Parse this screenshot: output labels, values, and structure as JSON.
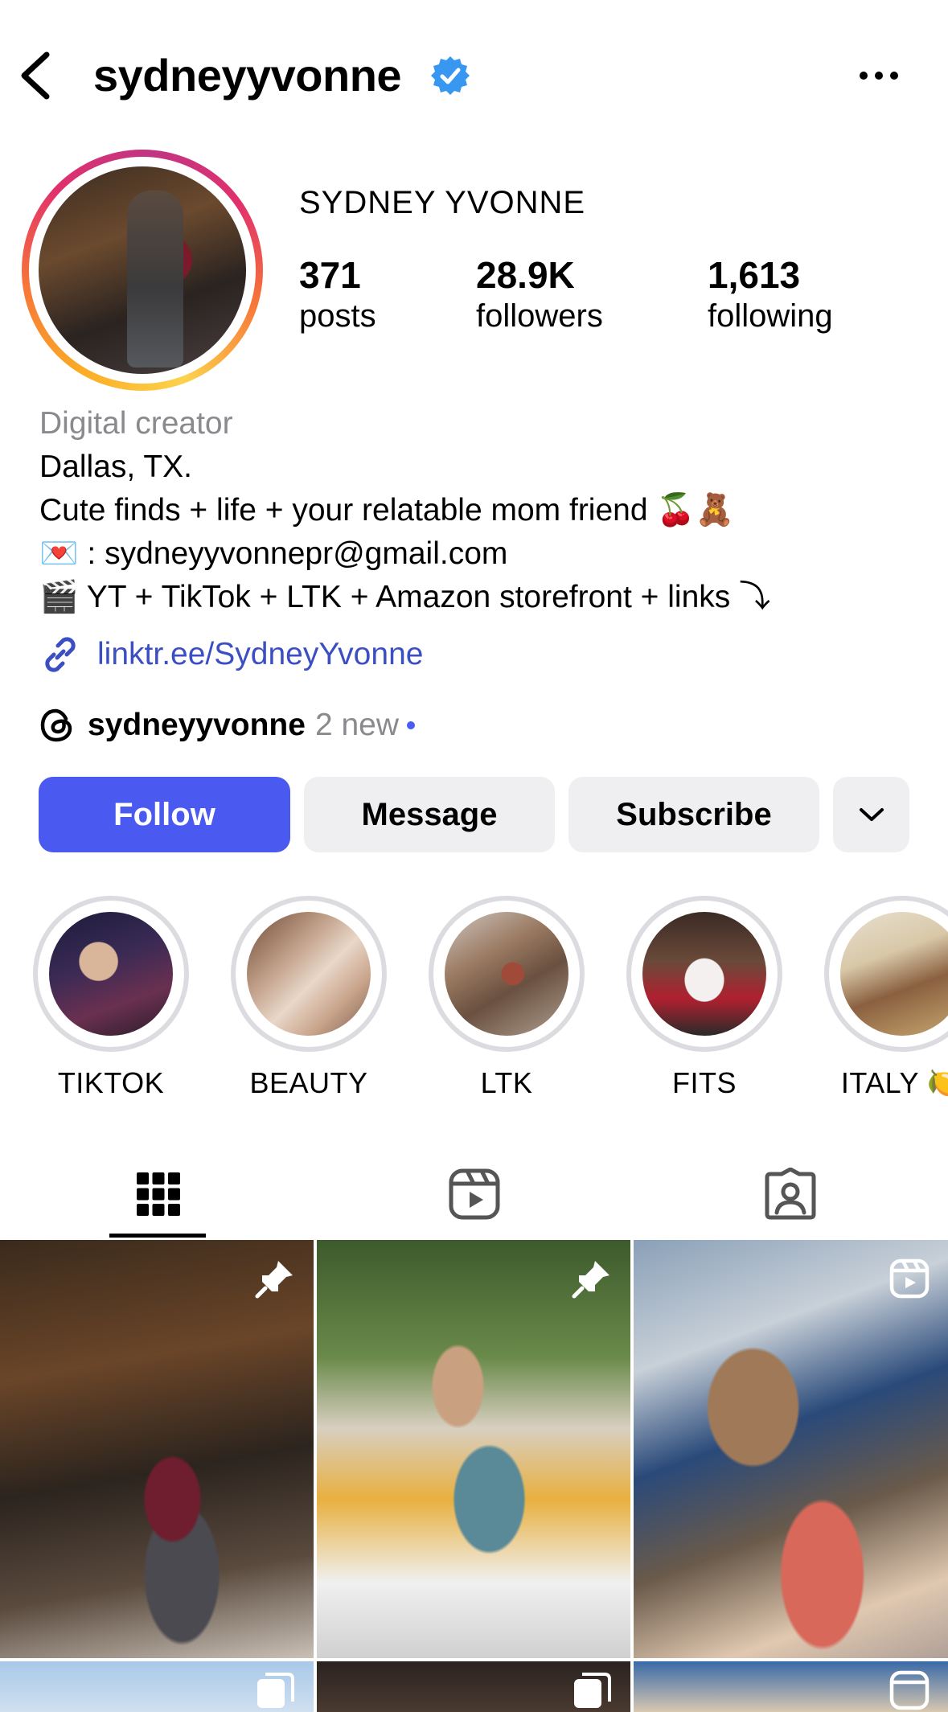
{
  "header": {
    "username": "sydneyyvonne",
    "back_icon": "chevron-left-icon",
    "verified_icon": "verified-badge-icon",
    "more_icon": "more-horizontal-icon"
  },
  "profile": {
    "full_name": "SYDNEY YVONNE",
    "stats": [
      {
        "value": "371",
        "label": "posts"
      },
      {
        "value": "28.9K",
        "label": "followers"
      },
      {
        "value": "1,613",
        "label": "following"
      }
    ],
    "category": "Digital creator",
    "bio_lines": [
      "Dallas, TX.",
      "Cute finds + life + your relatable mom friend 🍒🧸",
      "💌 : sydneyyvonnepr@gmail.com",
      "🎬 YT + TikTok + LTK + Amazon storefront + links ⤵︎"
    ],
    "link": "linktr.ee/SydneyYvonne",
    "link_icon": "link-icon",
    "threads": {
      "icon": "threads-icon",
      "name": "sydneyyvonne",
      "new_text": "2 new"
    }
  },
  "actions": {
    "follow": "Follow",
    "message": "Message",
    "subscribe": "Subscribe",
    "more_icon": "chevron-down-icon"
  },
  "highlights": [
    {
      "label": "TIKTOK"
    },
    {
      "label": "BEAUTY"
    },
    {
      "label": "LTK"
    },
    {
      "label": "FITS"
    },
    {
      "label": "ITALY 🍋"
    }
  ],
  "tabs": [
    {
      "name": "grid",
      "icon": "grid-icon",
      "active": true
    },
    {
      "name": "reels",
      "icon": "reels-icon",
      "active": false
    },
    {
      "name": "tagged",
      "icon": "tagged-user-icon",
      "active": false
    }
  ],
  "posts": [
    {
      "badge": "pin-icon"
    },
    {
      "badge": "pin-icon"
    },
    {
      "badge": "reel-icon"
    },
    {
      "badge": "carousel-icon"
    },
    {
      "badge": "carousel-icon"
    },
    {
      "badge": "reel-icon"
    }
  ],
  "colors": {
    "accent": "#4a5af0",
    "link": "#3c4fc2",
    "secondary_text": "#8a8a8e",
    "button_bg": "#efeff1"
  }
}
